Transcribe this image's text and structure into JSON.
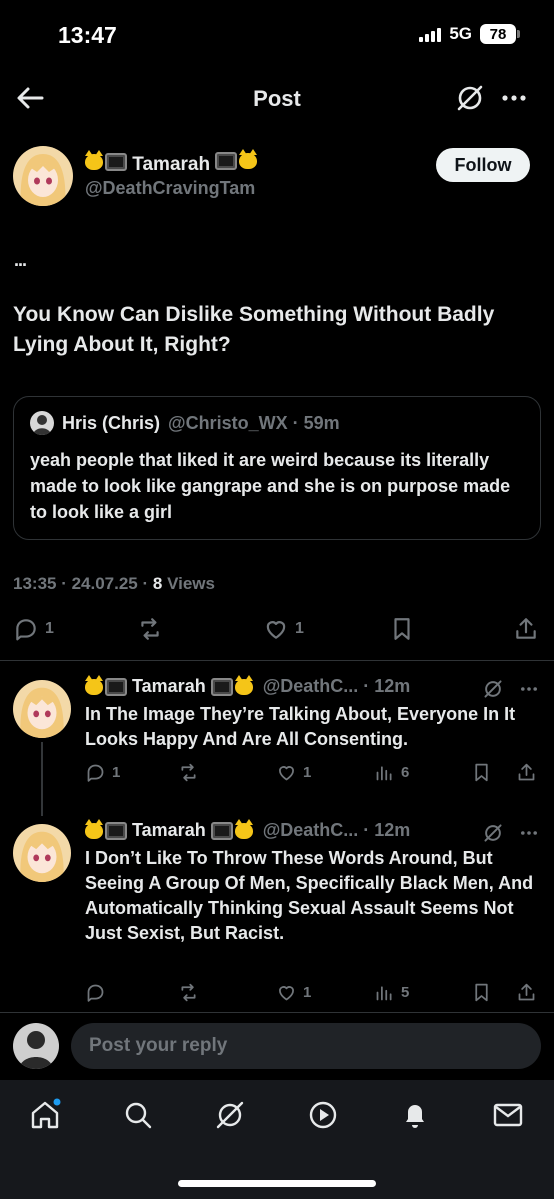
{
  "status": {
    "time": "13:47",
    "network": "5G",
    "battery": "78"
  },
  "nav": {
    "title": "Post"
  },
  "post": {
    "author_name": "Tamarah",
    "author_handle": "@DeathCravingTam",
    "follow_label": "Follow",
    "dots": "...",
    "text": "You Know Can Dislike Something Without Badly Lying About It, Right?",
    "quote": {
      "name": "Hris (Chris)",
      "handle_time": "@Christo_WX · 59m",
      "text": "yeah people that liked it are weird because its literally made to look like gangrape and she is on purpose made to look like a girl"
    },
    "meta_time": "13:35 · 24.07.25 · ",
    "views_count": "8",
    "views_label": " Views",
    "replies": "1",
    "likes": "1"
  },
  "replies": [
    {
      "name": "Tamarah",
      "handle_time": "@DeathC... · 12m",
      "text": "In The Image They’re Talking About, Everyone In It Looks Happy And Are All Consenting.",
      "replies": "1",
      "likes": "1",
      "views": "6"
    },
    {
      "name": "Tamarah",
      "handle_time": "@DeathC... · 12m",
      "text": "I Don’t Like To Throw These Words Around, But Seeing A Group Of Men, Specifically Black Men, And Automatically Thinking Sexual Assault Seems Not Just Sexist, But Racist.",
      "replies": "",
      "likes": "1",
      "views": "5"
    }
  ],
  "reply_bar": {
    "placeholder": "Post your reply"
  },
  "colors": {
    "background": "#000000",
    "muted": "#71767b",
    "text": "#e7e9ea",
    "accent": "#1d9bf0"
  },
  "icons": [
    "back-arrow-icon",
    "grok-icon",
    "more-icon",
    "reply-icon",
    "repost-icon",
    "like-icon",
    "bookmark-icon",
    "share-icon",
    "views-icon",
    "home-icon",
    "search-icon",
    "play-icon",
    "bell-icon",
    "mail-icon"
  ]
}
